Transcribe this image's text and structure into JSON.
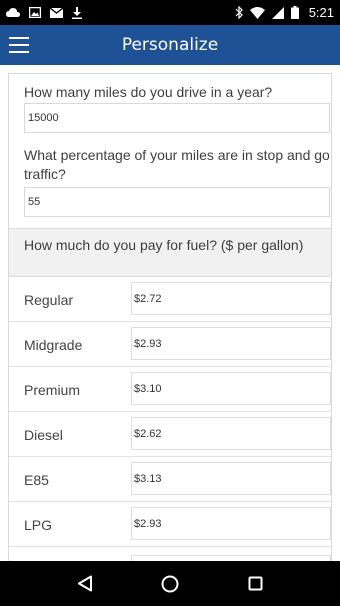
{
  "status_bar": {
    "time": "5:21",
    "icons_left": [
      "cloud-icon",
      "image-icon",
      "mail-icon",
      "download-icon"
    ],
    "icons_right": [
      "bluetooth-icon",
      "wifi-icon",
      "signal-icon",
      "battery-icon"
    ]
  },
  "app_bar": {
    "title": "Personalize",
    "menu_icon": "hamburger-menu-icon"
  },
  "form": {
    "miles_question": "How many miles do you drive in a year?",
    "miles_value": "15000",
    "traffic_question": "What percentage of your miles are in stop and go traffic?",
    "traffic_value": "55",
    "fuel_question": "How much do you pay for fuel? ($ per gallon)",
    "fuels": [
      {
        "label": "Regular",
        "price": "$2.72"
      },
      {
        "label": "Midgrade",
        "price": "$2.93"
      },
      {
        "label": "Premium",
        "price": "$3.10"
      },
      {
        "label": "Diesel",
        "price": "$2.62"
      },
      {
        "label": "E85",
        "price": "$3.13"
      },
      {
        "label": "LPG",
        "price": "$2.93"
      }
    ]
  },
  "nav_bar": {
    "buttons": [
      "back-icon",
      "home-icon",
      "recents-icon"
    ]
  },
  "colors": {
    "app_bar": "#1f5196",
    "status_bar": "#000000",
    "fuel_header_bg": "#f1f1f1"
  }
}
